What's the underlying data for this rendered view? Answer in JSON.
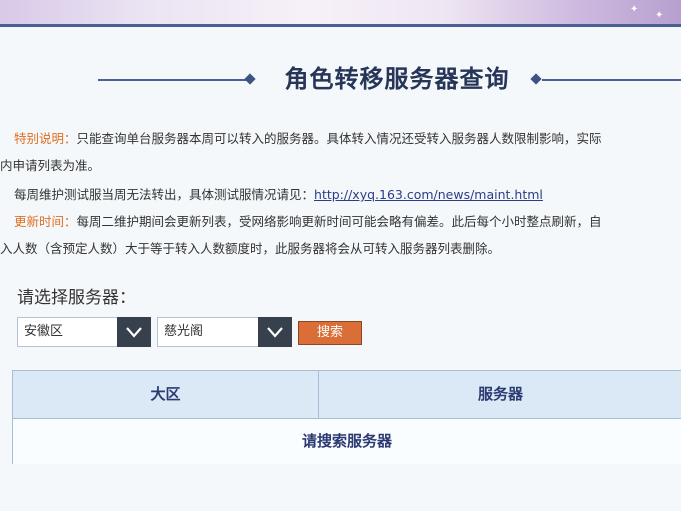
{
  "page": {
    "title": "角色转移服务器查询"
  },
  "notes": {
    "special_label": "特别说明：",
    "special_text_1": "只能查询单台服务器本周可以转入的服务器。具体转入情况还受转入服务器人数限制影响，实际",
    "special_text_2": "内申请列表为准。",
    "maint_text": "每周维护测试服当周无法转出，具体测试服情况请见：",
    "maint_link": "http://xyq.163.com/news/maint.html",
    "update_label": "更新时间：",
    "update_text_1": "每周二维护期间会更新列表，受网络影响更新时间可能会略有偏差。此后每个小时整点刷新，自",
    "update_text_2": "入人数（含预定人数）大于等于转入人数额度时，此服务器将会从可转入服务器列表删除。"
  },
  "selector": {
    "label": "请选择服务器：",
    "region_value": "安徽区",
    "server_value": "慈光阁",
    "search_label": "搜索"
  },
  "table": {
    "col_region": "大区",
    "col_server": "服务器",
    "empty_text": "请搜索服务器"
  },
  "colors": {
    "accent_orange": "#e06f22",
    "title_navy": "#263558",
    "button_orange": "#d96e36"
  }
}
